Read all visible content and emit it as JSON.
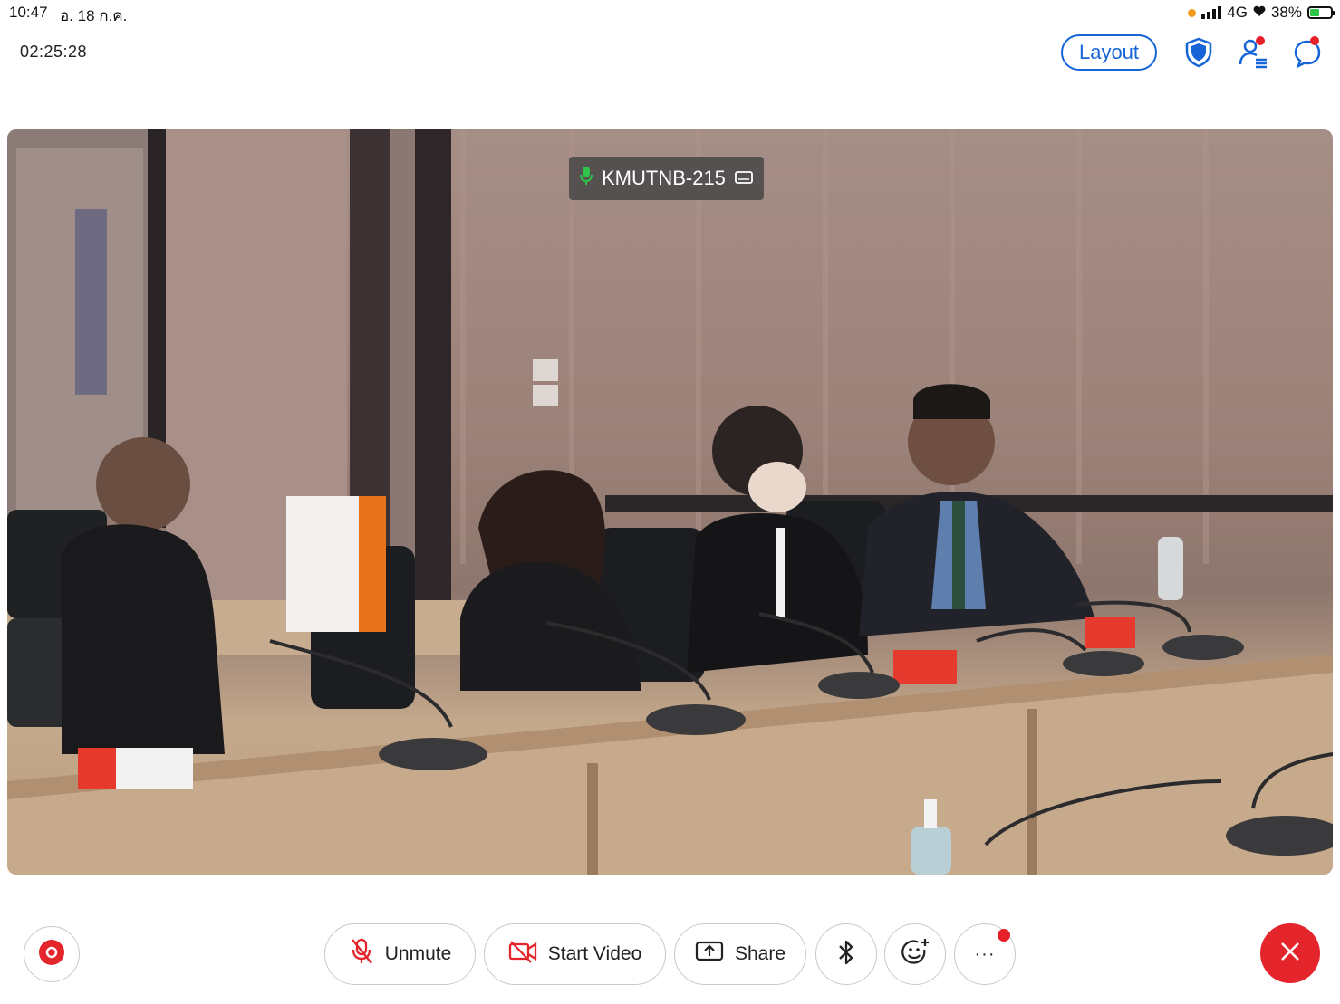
{
  "status_bar": {
    "time": "10:47",
    "date": "อ. 18 ก.ค.",
    "network": "4G",
    "battery": "38%"
  },
  "header": {
    "elapsed": "02:25:28",
    "layout_label": "Layout"
  },
  "video": {
    "participant_name": "KMUTNB-215"
  },
  "controls": {
    "unmute_label": "Unmute",
    "start_video_label": "Start Video",
    "share_label": "Share",
    "more_label": "···"
  },
  "colors": {
    "accent": "#1565d8",
    "danger": "#e4252b",
    "notification": "#e8202a"
  },
  "icons": [
    "shield-icon",
    "participants-icon",
    "chat-icon",
    "record-icon",
    "mic-off-icon",
    "video-off-icon",
    "share-screen-icon",
    "bluetooth-icon",
    "reaction-icon",
    "more-icon",
    "close-icon"
  ]
}
